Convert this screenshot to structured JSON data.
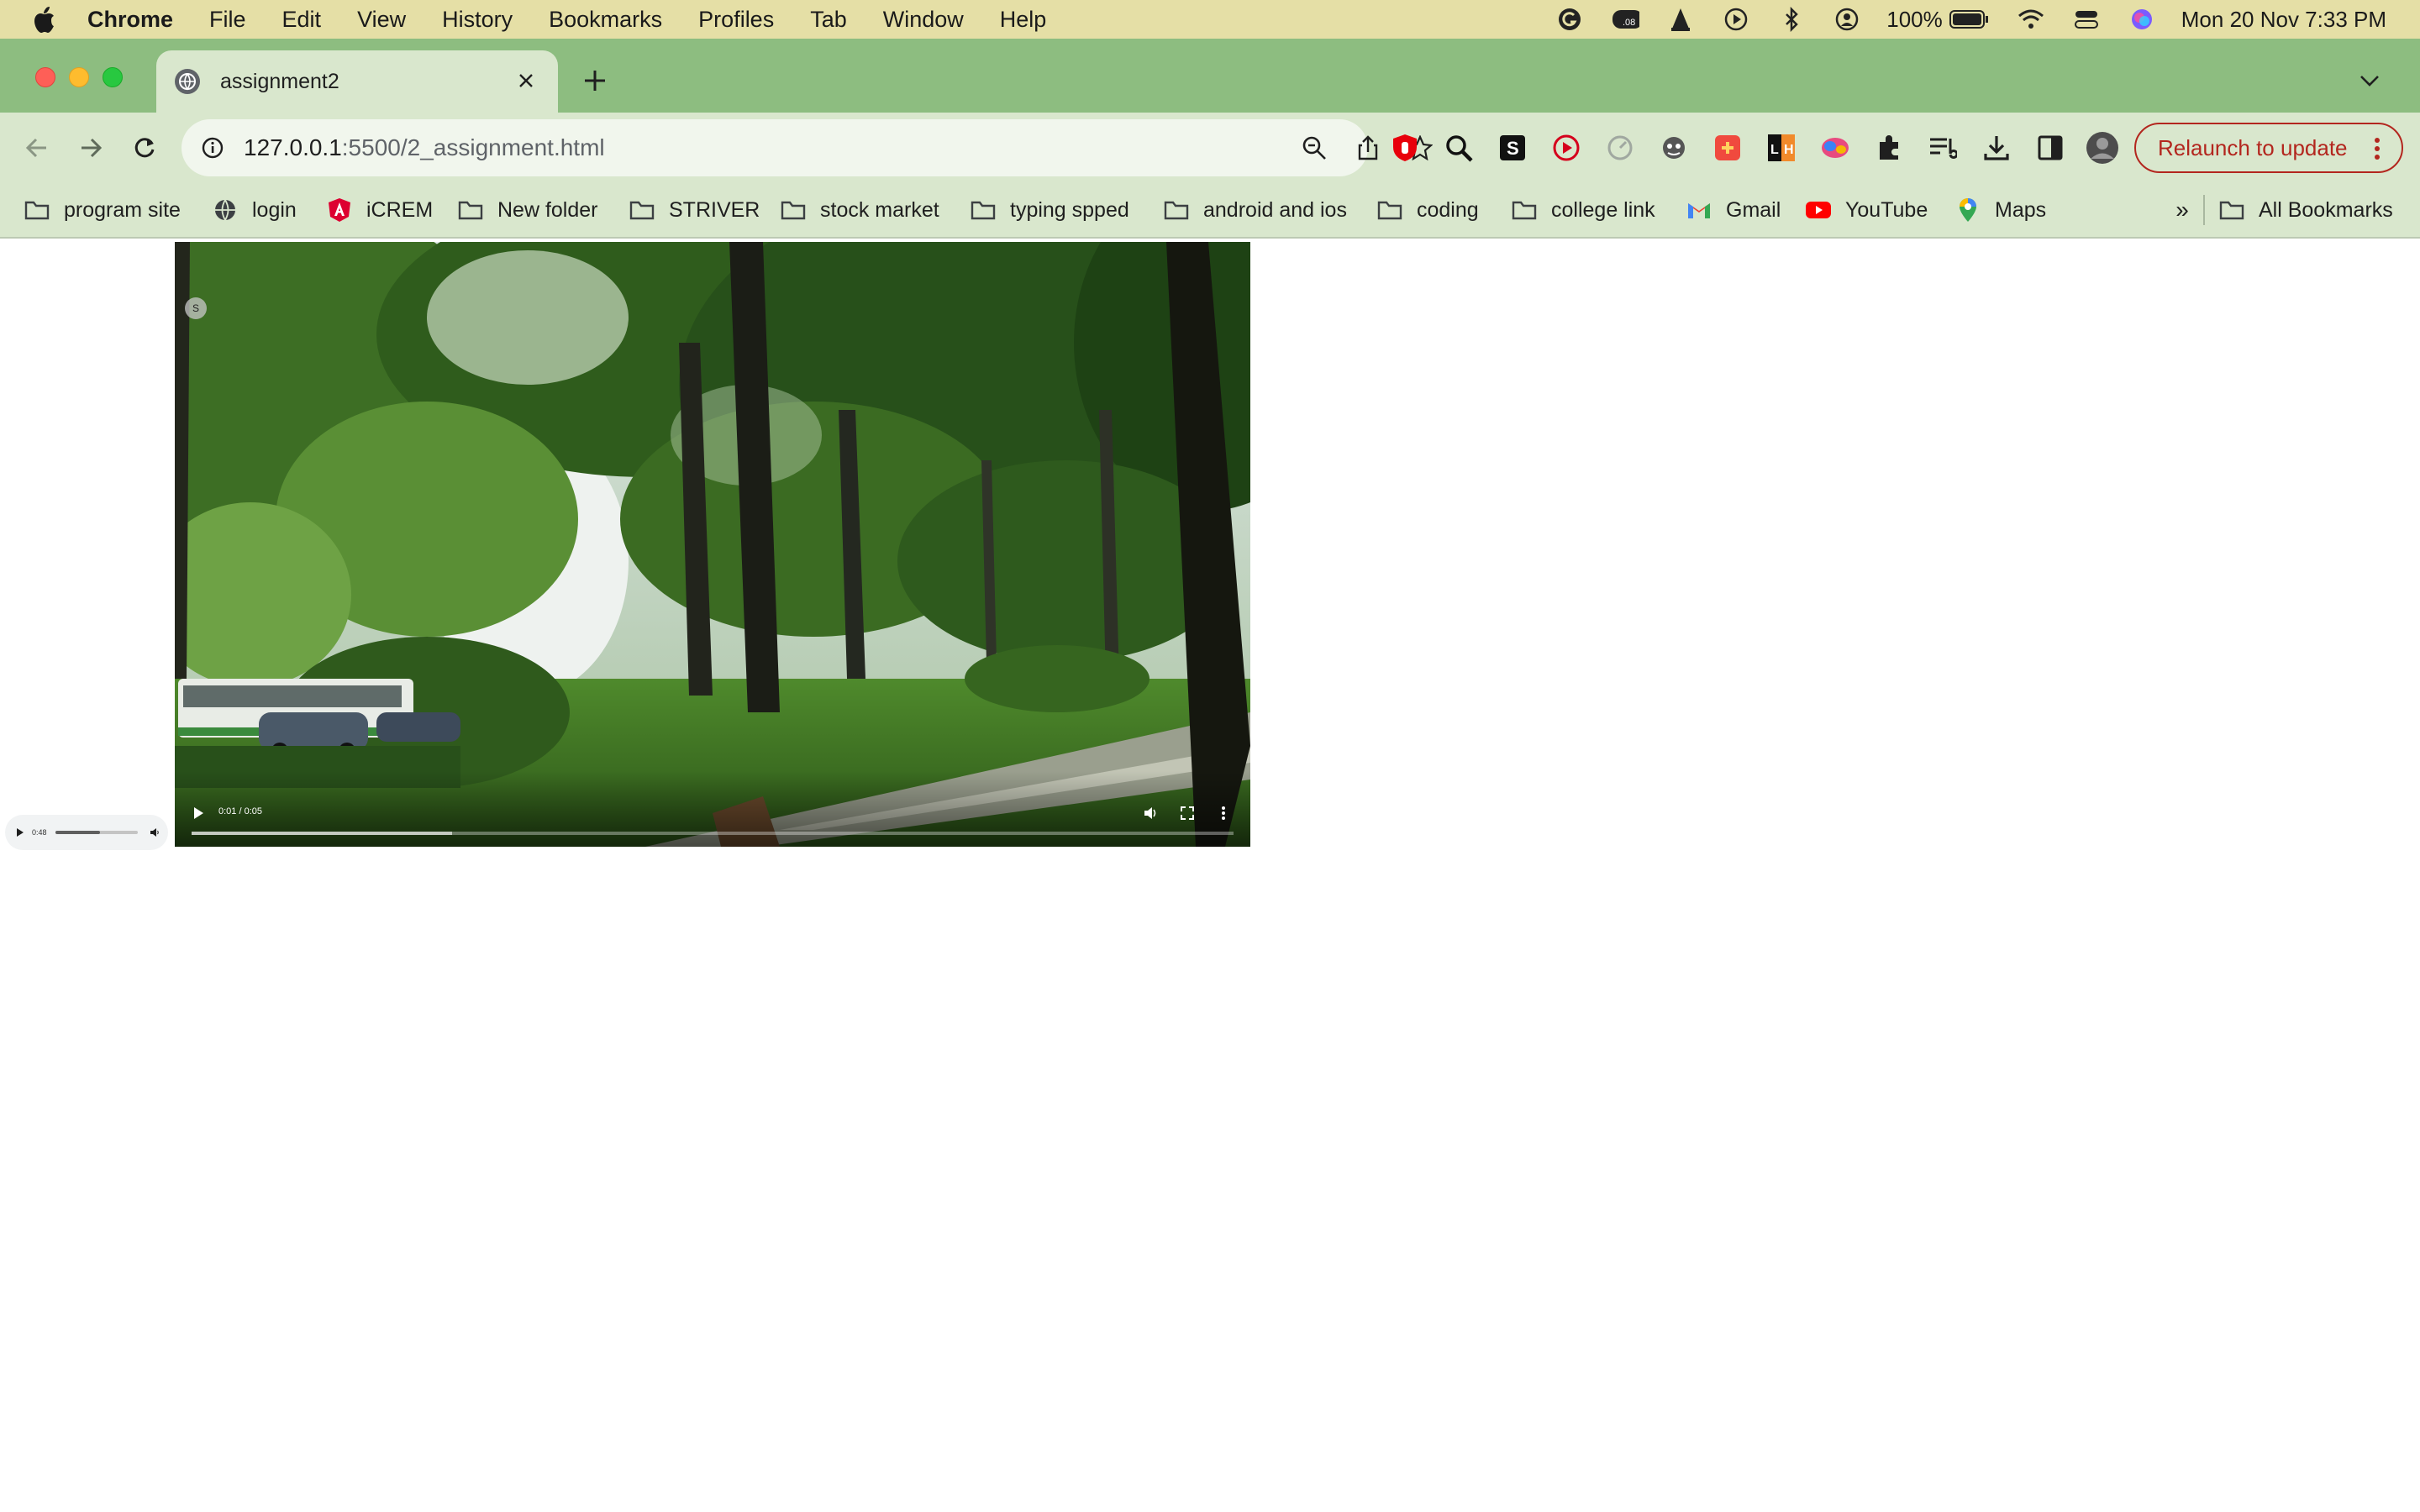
{
  "menubar": {
    "app_name": "Chrome",
    "menus": [
      "File",
      "Edit",
      "View",
      "History",
      "Bookmarks",
      "Profiles",
      "Tab",
      "Window",
      "Help"
    ],
    "battery": "100%",
    "datetime": "Mon 20 Nov  7:33 PM",
    "status_icons": [
      "grammarly-icon",
      "activity-monitor-icon",
      "vlc-icon",
      "play-icon",
      "bluetooth-icon",
      "user-icon",
      "battery-icon",
      "wifi-icon",
      "control-center-icon",
      "siri-icon"
    ]
  },
  "browser": {
    "tab_title": "assignment2",
    "url_host": "127.0.0.1",
    "url_rest": ":5500/2_assignment.html",
    "relaunch_label": "Relaunch to update"
  },
  "bookmarks": {
    "items": [
      {
        "label": "program site",
        "icon": "folder-icon"
      },
      {
        "label": "login",
        "icon": "globe-icon"
      },
      {
        "label": "iCREM",
        "icon": "angular-icon"
      },
      {
        "label": "New folder",
        "icon": "folder-icon"
      },
      {
        "label": "STRIVER",
        "icon": "folder-icon"
      },
      {
        "label": "stock market",
        "icon": "folder-icon"
      },
      {
        "label": "typing spped",
        "icon": "folder-icon"
      },
      {
        "label": "android and ios",
        "icon": "folder-icon"
      },
      {
        "label": "coding",
        "icon": "folder-icon"
      },
      {
        "label": "college link",
        "icon": "folder-icon"
      },
      {
        "label": "Gmail",
        "icon": "gmail-icon"
      },
      {
        "label": "YouTube",
        "icon": "youtube-icon"
      },
      {
        "label": "Maps",
        "icon": "maps-icon"
      }
    ],
    "overflow": "»",
    "all_bookmarks": "All Bookmarks"
  },
  "audio_player": {
    "time": "0:48",
    "progress": 0.55
  },
  "video_player": {
    "time": "0:01 / 0:05",
    "badge": "S",
    "played": 0.02,
    "buffered": 0.25
  },
  "colors": {
    "menubar": "#e5dfa6",
    "tabstrip": "#8dbd80",
    "toolbar": "#d9e7cd",
    "relaunch": "#b3261e"
  }
}
